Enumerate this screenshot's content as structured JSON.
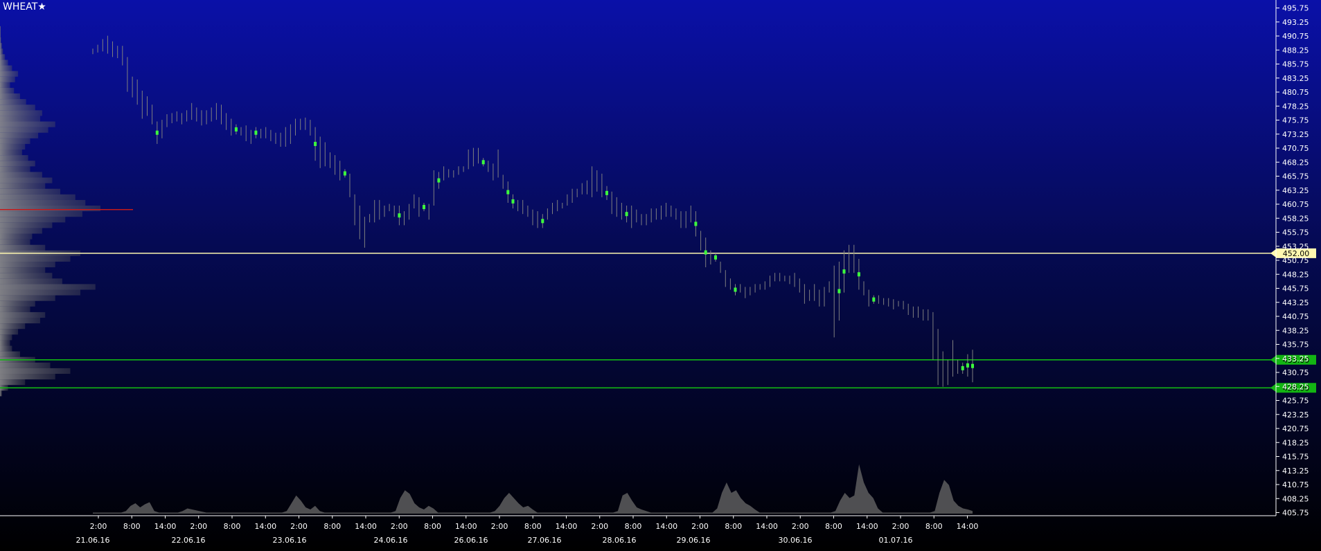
{
  "symbol": {
    "name": "WHEAT",
    "star": "★"
  },
  "colors": {
    "bg_top": "#0a10a8",
    "bg_mid": "#050a52",
    "bg_bottom": "#000000",
    "bar": "#7f7f7f",
    "highlight": "#3cff3c",
    "resistance": "#fff8b0",
    "support": "#13b513",
    "poc": "#c41a1a",
    "axis": "#ffffff",
    "volume_fill": "#6a6a6a"
  },
  "chart_data": {
    "type": "ohlc",
    "title": "",
    "xlabel": "",
    "ylabel": "",
    "ylim": [
      404.5,
      497
    ],
    "grid": false,
    "y_ticks": [
      "495.75",
      "493.25",
      "490.75",
      "488.25",
      "485.75",
      "483.25",
      "480.75",
      "478.25",
      "475.75",
      "473.25",
      "470.75",
      "468.25",
      "465.75",
      "463.25",
      "460.75",
      "458.25",
      "455.75",
      "453.25",
      "450.75",
      "448.25",
      "445.75",
      "443.25",
      "440.75",
      "438.25",
      "435.75",
      "433.25",
      "430.75",
      "428.25",
      "425.75",
      "423.25",
      "420.75",
      "418.25",
      "415.75",
      "413.25",
      "410.75",
      "408.25",
      "405.75"
    ],
    "time_ticks": [
      "2:00",
      "8:00",
      "14:00",
      "2:00",
      "8:00",
      "14:00",
      "2:00",
      "8:00",
      "14:00",
      "2:00",
      "8:00",
      "14:00",
      "2:00",
      "8:00",
      "14:00",
      "2:00",
      "8:00",
      "14:00",
      "2:00",
      "8:00",
      "14:00",
      "2:00",
      "8:00",
      "14:00",
      "2:00",
      "8:00",
      "14:00"
    ],
    "date_ticks": [
      "21.06.16",
      "22.06.16",
      "23.06.16",
      "24.06.16",
      "26.06.16",
      "27.06.16",
      "28.06.16",
      "29.06.16",
      "30.06.16",
      "01.07.16"
    ],
    "levels": [
      {
        "value": 452.0,
        "label": "452.00",
        "kind": "resistance"
      },
      {
        "value": 433.0,
        "label": "433.00",
        "kind": "support"
      },
      {
        "value": 428.0,
        "label": "428.00",
        "kind": "support"
      }
    ],
    "poc_level": 459.8,
    "bars": [
      [
        487.5,
        488.5
      ],
      [
        487.8,
        489.2
      ],
      [
        488.0,
        490.2
      ],
      [
        487.6,
        490.8
      ],
      [
        487.0,
        489.8
      ],
      [
        486.8,
        489.0
      ],
      [
        485.5,
        489.0
      ],
      [
        480.8,
        487.0
      ],
      [
        479.8,
        483.5
      ],
      [
        478.5,
        483.0
      ],
      [
        476.0,
        481.0
      ],
      [
        476.5,
        480.0
      ],
      [
        475.0,
        478.5
      ],
      [
        471.5,
        475.5
      ],
      [
        472.5,
        475.8
      ],
      [
        474.5,
        476.8
      ],
      [
        475.2,
        477.0
      ],
      [
        475.5,
        477.3
      ],
      [
        475.0,
        477.0
      ],
      [
        475.5,
        477.5
      ],
      [
        475.8,
        478.8
      ],
      [
        475.5,
        478.0
      ],
      [
        474.8,
        477.5
      ],
      [
        475.0,
        477.5
      ],
      [
        475.5,
        478.0
      ],
      [
        475.8,
        478.8
      ],
      [
        475.0,
        478.5
      ],
      [
        474.0,
        477.0
      ],
      [
        473.0,
        476.0
      ],
      [
        473.2,
        475.0
      ],
      [
        473.0,
        474.5
      ],
      [
        472.0,
        474.8
      ],
      [
        471.5,
        474.0
      ],
      [
        472.5,
        474.5
      ],
      [
        472.5,
        474.2
      ],
      [
        472.5,
        474.5
      ],
      [
        472.0,
        474.0
      ],
      [
        471.5,
        473.5
      ],
      [
        471.0,
        473.5
      ],
      [
        471.0,
        474.5
      ],
      [
        471.5,
        475.0
      ],
      [
        473.0,
        476.0
      ],
      [
        474.0,
        476.0
      ],
      [
        474.0,
        476.2
      ],
      [
        473.0,
        475.8
      ],
      [
        468.5,
        474.5
      ],
      [
        467.2,
        472.8
      ],
      [
        467.5,
        471.8
      ],
      [
        467.2,
        470.0
      ],
      [
        466.0,
        469.5
      ],
      [
        465.0,
        468.5
      ],
      [
        465.5,
        467.0
      ],
      [
        462.0,
        466.2
      ],
      [
        457.0,
        462.5
      ],
      [
        454.5,
        460.5
      ],
      [
        453.0,
        458.5
      ],
      [
        457.5,
        459.0
      ],
      [
        457.5,
        461.5
      ],
      [
        458.0,
        461.5
      ],
      [
        458.5,
        460.5
      ],
      [
        459.5,
        460.8
      ],
      [
        458.5,
        460.5
      ],
      [
        457.0,
        460.5
      ],
      [
        457.0,
        459.5
      ],
      [
        458.0,
        460.8
      ],
      [
        460.0,
        462.5
      ],
      [
        458.5,
        462.0
      ],
      [
        459.5,
        461.0
      ],
      [
        458.0,
        460.8
      ],
      [
        460.5,
        466.8
      ],
      [
        463.5,
        466.5
      ],
      [
        465.0,
        467.5
      ],
      [
        465.5,
        467.0
      ],
      [
        465.5,
        466.8
      ],
      [
        466.0,
        467.5
      ],
      [
        466.5,
        467.5
      ],
      [
        467.0,
        470.5
      ],
      [
        467.5,
        470.8
      ],
      [
        468.0,
        470.8
      ],
      [
        467.5,
        469.0
      ],
      [
        466.5,
        468.5
      ],
      [
        465.0,
        468.0
      ],
      [
        465.5,
        470.5
      ],
      [
        463.5,
        466.0
      ],
      [
        461.0,
        464.8
      ],
      [
        460.0,
        462.5
      ],
      [
        459.5,
        461.5
      ],
      [
        459.0,
        461.5
      ],
      [
        458.5,
        460.5
      ],
      [
        457.0,
        459.8
      ],
      [
        456.5,
        459.5
      ],
      [
        456.5,
        459.0
      ],
      [
        458.0,
        460.0
      ],
      [
        459.0,
        461.0
      ],
      [
        459.5,
        461.5
      ],
      [
        460.0,
        461.0
      ],
      [
        460.5,
        462.5
      ],
      [
        461.0,
        463.5
      ],
      [
        462.0,
        463.5
      ],
      [
        462.5,
        464.5
      ],
      [
        462.5,
        465.0
      ],
      [
        462.0,
        467.5
      ],
      [
        463.0,
        466.8
      ],
      [
        462.0,
        466.2
      ],
      [
        461.5,
        464.0
      ],
      [
        459.0,
        463.0
      ],
      [
        458.5,
        462.0
      ],
      [
        458.0,
        461.0
      ],
      [
        457.5,
        460.5
      ],
      [
        456.5,
        460.5
      ],
      [
        457.5,
        459.8
      ],
      [
        457.0,
        459.0
      ],
      [
        457.0,
        459.0
      ],
      [
        457.5,
        460.0
      ],
      [
        458.0,
        460.0
      ],
      [
        458.0,
        460.5
      ],
      [
        458.5,
        461.0
      ],
      [
        458.5,
        460.5
      ],
      [
        458.0,
        460.0
      ],
      [
        456.5,
        459.5
      ],
      [
        456.5,
        459.5
      ],
      [
        457.5,
        460.5
      ],
      [
        455.0,
        459.5
      ],
      [
        452.5,
        456.0
      ],
      [
        449.5,
        454.8
      ],
      [
        450.0,
        452.5
      ],
      [
        450.5,
        452.0
      ],
      [
        448.5,
        450.5
      ],
      [
        446.0,
        449.0
      ],
      [
        445.5,
        447.5
      ],
      [
        444.5,
        446.5
      ],
      [
        445.0,
        446.5
      ],
      [
        444.0,
        446.0
      ],
      [
        444.5,
        446.0
      ],
      [
        445.0,
        446.5
      ],
      [
        445.5,
        446.5
      ],
      [
        445.5,
        447.0
      ],
      [
        446.0,
        448.0
      ],
      [
        447.0,
        448.5
      ],
      [
        447.0,
        448.5
      ],
      [
        447.0,
        448.0
      ],
      [
        446.5,
        448.0
      ],
      [
        446.0,
        448.5
      ],
      [
        445.0,
        447.5
      ],
      [
        443.0,
        446.5
      ],
      [
        443.5,
        445.5
      ],
      [
        443.5,
        446.5
      ],
      [
        442.5,
        445.5
      ],
      [
        442.5,
        446.0
      ],
      [
        445.0,
        447.0
      ],
      [
        437.0,
        449.8
      ],
      [
        440.0,
        450.5
      ],
      [
        445.0,
        452.5
      ],
      [
        448.5,
        453.5
      ],
      [
        448.5,
        453.5
      ],
      [
        445.5,
        451.0
      ],
      [
        444.5,
        447.0
      ],
      [
        442.5,
        445.5
      ],
      [
        443.0,
        444.5
      ],
      [
        443.0,
        444.5
      ],
      [
        442.8,
        444.0
      ],
      [
        442.5,
        444.0
      ],
      [
        442.0,
        443.8
      ],
      [
        442.5,
        443.5
      ],
      [
        442.0,
        443.5
      ],
      [
        441.0,
        443.0
      ],
      [
        440.5,
        442.5
      ],
      [
        440.5,
        442.5
      ],
      [
        440.0,
        442.0
      ],
      [
        440.0,
        442.0
      ],
      [
        433.0,
        441.5
      ],
      [
        428.5,
        438.5
      ],
      [
        428.2,
        434.5
      ],
      [
        428.5,
        433.0
      ],
      [
        430.0,
        436.5
      ],
      [
        430.5,
        433.0
      ],
      [
        430.5,
        432.5
      ],
      [
        430.0,
        434.0
      ],
      [
        429.0,
        434.8
      ]
    ],
    "volume_profile": [
      [
        492.0,
        0.0
      ],
      [
        491.0,
        0.0
      ],
      [
        490.0,
        0.01
      ],
      [
        489.0,
        0.02
      ],
      [
        488.0,
        0.03
      ],
      [
        487.0,
        0.05
      ],
      [
        486.0,
        0.08
      ],
      [
        485.0,
        0.12
      ],
      [
        484.0,
        0.18
      ],
      [
        483.0,
        0.15
      ],
      [
        482.0,
        0.1
      ],
      [
        481.0,
        0.14
      ],
      [
        480.0,
        0.2
      ],
      [
        479.0,
        0.26
      ],
      [
        478.0,
        0.35
      ],
      [
        477.0,
        0.42
      ],
      [
        476.0,
        0.4
      ],
      [
        475.0,
        0.55
      ],
      [
        474.0,
        0.48
      ],
      [
        473.0,
        0.38
      ],
      [
        472.0,
        0.3
      ],
      [
        471.0,
        0.25
      ],
      [
        470.0,
        0.22
      ],
      [
        469.0,
        0.28
      ],
      [
        468.0,
        0.35
      ],
      [
        467.0,
        0.3
      ],
      [
        466.0,
        0.42
      ],
      [
        465.0,
        0.52
      ],
      [
        464.0,
        0.45
      ],
      [
        463.0,
        0.6
      ],
      [
        462.0,
        0.75
      ],
      [
        461.0,
        0.85
      ],
      [
        460.0,
        1.0
      ],
      [
        459.0,
        0.82
      ],
      [
        458.0,
        0.65
      ],
      [
        457.0,
        0.52
      ],
      [
        456.0,
        0.42
      ],
      [
        455.0,
        0.32
      ],
      [
        454.0,
        0.3
      ],
      [
        453.0,
        0.45
      ],
      [
        452.0,
        0.8
      ],
      [
        451.0,
        0.7
      ],
      [
        450.0,
        0.55
      ],
      [
        449.0,
        0.45
      ],
      [
        448.0,
        0.52
      ],
      [
        447.0,
        0.62
      ],
      [
        446.0,
        0.95
      ],
      [
        445.0,
        0.8
      ],
      [
        444.0,
        0.55
      ],
      [
        443.0,
        0.35
      ],
      [
        442.0,
        0.3
      ],
      [
        441.0,
        0.45
      ],
      [
        440.0,
        0.4
      ],
      [
        439.0,
        0.25
      ],
      [
        438.0,
        0.18
      ],
      [
        437.0,
        0.12
      ],
      [
        436.0,
        0.1
      ],
      [
        435.0,
        0.12
      ],
      [
        434.0,
        0.2
      ],
      [
        433.0,
        0.35
      ],
      [
        432.0,
        0.5
      ],
      [
        431.0,
        0.7
      ],
      [
        430.0,
        0.55
      ],
      [
        429.0,
        0.25
      ],
      [
        428.0,
        0.08
      ],
      [
        427.0,
        0.02
      ]
    ],
    "volume": [
      0.02,
      0.02,
      0.02,
      0.02,
      0.02,
      0.02,
      0.02,
      0.05,
      0.15,
      0.2,
      0.12,
      0.18,
      0.22,
      0.05,
      0.02,
      0.02,
      0.02,
      0.02,
      0.02,
      0.05,
      0.1,
      0.08,
      0.06,
      0.04,
      0.02,
      0.02,
      0.02,
      0.02,
      0.02,
      0.02,
      0.02,
      0.02,
      0.02,
      0.02,
      0.02,
      0.02,
      0.02,
      0.02,
      0.02,
      0.02,
      0.02,
      0.05,
      0.2,
      0.35,
      0.25,
      0.12,
      0.08,
      0.15,
      0.05,
      0.02,
      0.02,
      0.02,
      0.02,
      0.02,
      0.02,
      0.02,
      0.02,
      0.02,
      0.02,
      0.02,
      0.02,
      0.02,
      0.02,
      0.02,
      0.05,
      0.3,
      0.45,
      0.38,
      0.2,
      0.12,
      0.08,
      0.15,
      0.1,
      0.02,
      0.02,
      0.02,
      0.02,
      0.02,
      0.02,
      0.02,
      0.02,
      0.02,
      0.02,
      0.02,
      0.02,
      0.05,
      0.15,
      0.3,
      0.4,
      0.3,
      0.2,
      0.12,
      0.15,
      0.08,
      0.02,
      0.02,
      0.02,
      0.02,
      0.02,
      0.02,
      0.02,
      0.02,
      0.02,
      0.02,
      0.02,
      0.02,
      0.02,
      0.02,
      0.02,
      0.02,
      0.02,
      0.05,
      0.35,
      0.4,
      0.25,
      0.12,
      0.08,
      0.05,
      0.02,
      0.02,
      0.02,
      0.02,
      0.02,
      0.02,
      0.02,
      0.02,
      0.02,
      0.02,
      0.02,
      0.02,
      0.02,
      0.02,
      0.1,
      0.4,
      0.6,
      0.4,
      0.45,
      0.3,
      0.2,
      0.15,
      0.08,
      0.02,
      0.02,
      0.02,
      0.02,
      0.02,
      0.02,
      0.02,
      0.02,
      0.02,
      0.02,
      0.02,
      0.02,
      0.02,
      0.02,
      0.02,
      0.02,
      0.05,
      0.25,
      0.4,
      0.3,
      0.35,
      0.95,
      0.6,
      0.4,
      0.3,
      0.1,
      0.02,
      0.02,
      0.02,
      0.02,
      0.02,
      0.02,
      0.02,
      0.02,
      0.02,
      0.02,
      0.02,
      0.05,
      0.4,
      0.65,
      0.55,
      0.25,
      0.15,
      0.1,
      0.08,
      0.05
    ]
  }
}
